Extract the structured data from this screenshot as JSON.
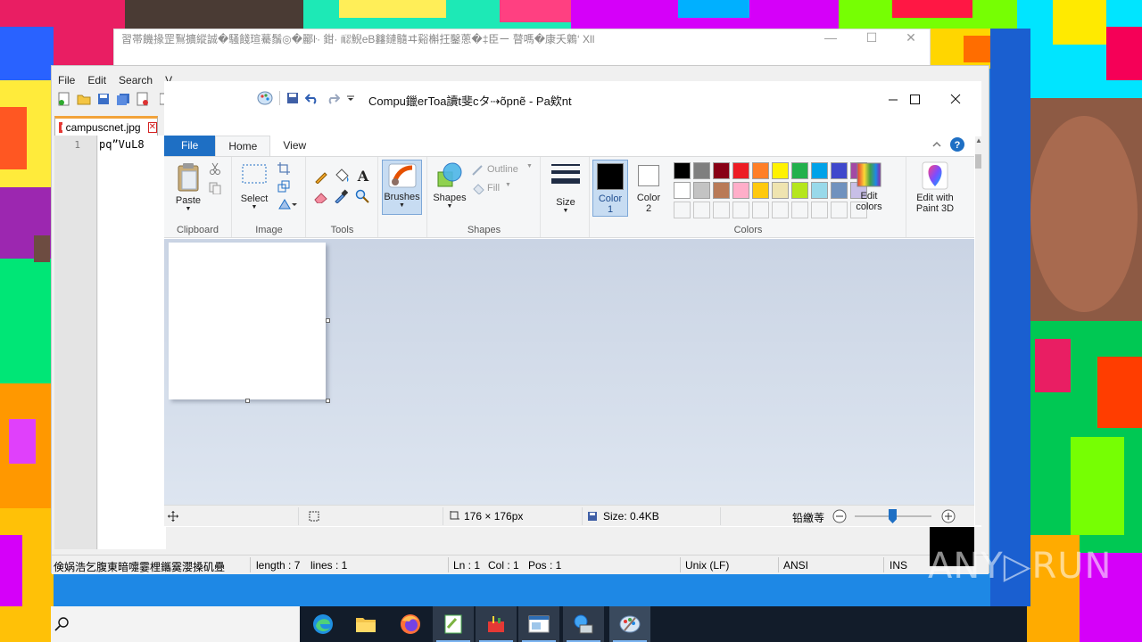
{
  "background_window": {
    "title": "習帯饑掾罡鴷擴縱誠�騷餞瑄驀鬚◎�酈ŀ· 鉗· 𦓖鯢eB𨰻鏈髓ヰ谿槲抂鑿蔥�‡臣ー 瞽嗎�康夭鷍‘ Xll"
  },
  "notepad_pp": {
    "menu": [
      "File",
      "Edit",
      "Search",
      "V"
    ],
    "tab": {
      "name": "campuscnet.jpg",
      "close": "✕"
    },
    "line_number": "1",
    "content": "pq”VuL8",
    "status": {
      "lang": "倹娲浩乞腹東暗嚏霎梩鑴霙瀴搡矶疉",
      "length": "length : 7",
      "lines": "lines : 1",
      "ln": "Ln : 1",
      "col": "Col : 1",
      "pos": "Pos : 1",
      "eol": "Unix (LF)",
      "encoding": "ANSI",
      "mode": "INS"
    }
  },
  "paint": {
    "title": "Compu鑞erToa讀t斐cタ⇢õpnẽ - Pa欸nt",
    "tabs": {
      "file": "File",
      "home": "Home",
      "view": "View"
    },
    "groups": {
      "clipboard": "Clipboard",
      "image": "Image",
      "tools": "Tools",
      "shapes": "Shapes",
      "colors": "Colors"
    },
    "buttons": {
      "paste": "Paste",
      "select": "Select",
      "brushes": "Brushes",
      "shapes": "Shapes",
      "outline": "Outline",
      "fill": "Fill",
      "size": "Size",
      "color1_a": "Color",
      "color1_b": "1",
      "color2_a": "Color",
      "color2_b": "2",
      "edit_colors_a": "Edit",
      "edit_colors_b": "colors",
      "paint3d_a": "Edit with",
      "paint3d_b": "Paint 3D"
    },
    "palette_row1": [
      "#000000",
      "#7f7f7f",
      "#880015",
      "#ed1c24",
      "#ff7f27",
      "#fff200",
      "#22b14c",
      "#00a2e8",
      "#3f48cc",
      "#a349a4"
    ],
    "palette_row2": [
      "#ffffff",
      "#c3c3c3",
      "#b97a57",
      "#ffaec9",
      "#ffc90e",
      "#efe4b0",
      "#b5e61d",
      "#99d9ea",
      "#7092be",
      "#c8bfe7"
    ],
    "color1": "#000000",
    "color2": "#ffffff",
    "status": {
      "dimensions": "176 × 176px",
      "size": "Size: 0.4KB",
      "zoom_label": "铅繳䓁"
    }
  },
  "watermark": "ANY▷RUN"
}
